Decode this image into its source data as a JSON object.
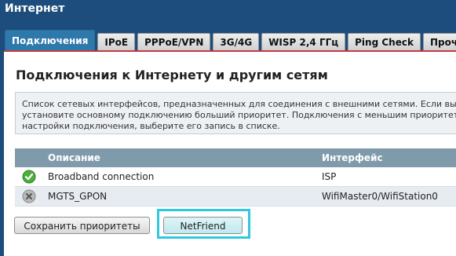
{
  "app": {
    "title": "Интернет"
  },
  "tabs": [
    {
      "label": "Подключения",
      "active": true
    },
    {
      "label": "IPoE"
    },
    {
      "label": "PPPoE/VPN"
    },
    {
      "label": "3G/4G"
    },
    {
      "label": "WISP 2,4 ГГц"
    },
    {
      "label": "Ping Check"
    },
    {
      "label": "Прочее"
    }
  ],
  "main": {
    "title": "Подключения к Интернету и другим сетям",
    "info": "Список сетевых интерфейсов, предназначенных для соединения с внешними сетями. Если вы\nустановите основному подключению больший приоритет. Подключения с меньшим приоритет\nнастройки подключения, выберите его запись в списке."
  },
  "table": {
    "headers": {
      "description": "Описание",
      "interface": "Интерфейс"
    },
    "rows": [
      {
        "status": "connected",
        "description": "Broadband connection",
        "interface": "ISP"
      },
      {
        "status": "disconnected",
        "description": "MGTS_GPON",
        "interface": "WifiMaster0/WifiStation0"
      }
    ]
  },
  "buttons": {
    "save_priorities": "Сохранить приоритеты",
    "netfriend": "NetFriend"
  },
  "colors": {
    "accent": "#2e79ab",
    "header_bg": "#1d4d7c",
    "table_header": "#7f9bab",
    "highlight": "#2fc8dc"
  }
}
